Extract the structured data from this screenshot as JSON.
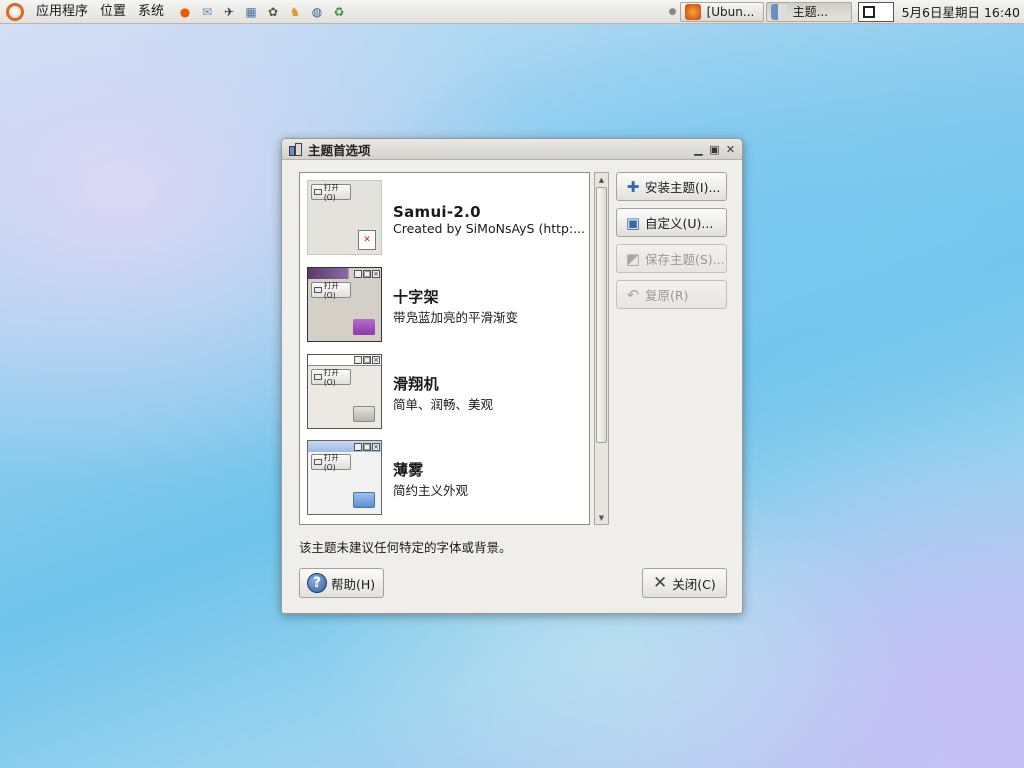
{
  "panel": {
    "menus": [
      "应用程序",
      "位置",
      "系统"
    ],
    "launchers": [
      {
        "icon": "firefox-icon",
        "glyph": "●",
        "color": "#e66000"
      },
      {
        "icon": "mail-icon",
        "glyph": "✉",
        "color": "#6a86a8"
      },
      {
        "icon": "bird-icon",
        "glyph": "✈",
        "color": "#333333"
      },
      {
        "icon": "network-icon",
        "glyph": "▦",
        "color": "#4d6f99"
      },
      {
        "icon": "gimp-icon",
        "glyph": "✿",
        "color": "#5a5a40"
      },
      {
        "icon": "figure-icon",
        "glyph": "♞",
        "color": "#d99a1f"
      },
      {
        "icon": "globe-icon",
        "glyph": "◍",
        "color": "#395b8c"
      },
      {
        "icon": "recycle-icon",
        "glyph": "♻",
        "color": "#2f8a2f"
      }
    ],
    "tasks": [
      {
        "label": "[Ubun...",
        "icon": "firefox-icon",
        "active": false
      },
      {
        "label": "主题...",
        "icon": "theme-icon",
        "active": true
      }
    ],
    "clock": "5月6日星期日 16:40"
  },
  "dialog": {
    "title": "主题首选项",
    "themes": [
      {
        "name": "Samui-2.0",
        "description": "Created by SiMoNsAyS (http:...",
        "thumb_style": "samui",
        "open_label": "打开(O)"
      },
      {
        "name": "十字架",
        "description": "带凫蓝加亮的平滑渐变",
        "thumb_style": "shizi",
        "open_label": "打开(O)"
      },
      {
        "name": "滑翔机",
        "description": "简单、润畅、美观",
        "thumb_style": "glider",
        "open_label": "打开(O)"
      },
      {
        "name": "薄雾",
        "description": "简约主义外观",
        "thumb_style": "mist",
        "open_label": "打开(O)"
      }
    ],
    "side_buttons": [
      {
        "label": "安装主题(I)...",
        "icon": "plus-icon",
        "glyph": "✚",
        "enabled": true
      },
      {
        "label": "自定义(U)...",
        "icon": "customize-icon",
        "glyph": "▣",
        "enabled": true
      },
      {
        "label": "保存主题(S)...",
        "icon": "save-icon",
        "glyph": "◩",
        "enabled": false
      },
      {
        "label": "复原(R)",
        "icon": "revert-icon",
        "glyph": "↶",
        "enabled": false
      }
    ],
    "status": "该主题未建议任何特定的字体或背景。",
    "help_label": "帮助(H)",
    "close_label": "关闭(C)"
  }
}
